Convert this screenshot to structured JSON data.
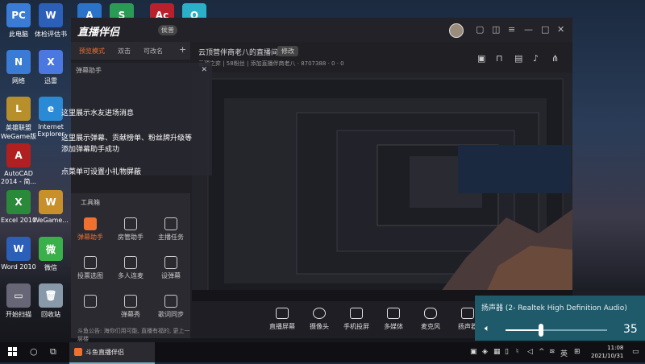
{
  "desktop": {
    "icons": [
      {
        "label": "此电脑",
        "color": "#3a7bd5",
        "glyph": "PC"
      },
      {
        "label": "体检评估书",
        "color": "#2b5fb8",
        "glyph": "W"
      },
      {
        "label": "",
        "color": "#2a73c9",
        "glyph": "A"
      },
      {
        "label": "",
        "color": "#2b9a55",
        "glyph": "S"
      },
      {
        "label": "",
        "color": "#b8202b",
        "glyph": "Ac"
      },
      {
        "label": "",
        "color": "#2ab0c8",
        "glyph": "O"
      },
      {
        "label": "网络",
        "color": "#3a7bd5",
        "glyph": "N"
      },
      {
        "label": "迅雷",
        "color": "#4a78e0",
        "glyph": "X"
      },
      {
        "label": "英雄联盟WeGame版",
        "color": "#b8902b",
        "glyph": "L"
      },
      {
        "label": "Internet Explorer",
        "color": "#2a8ad5",
        "glyph": "e"
      },
      {
        "label": "AutoCAD 2014 - 简...",
        "color": "#b02020",
        "glyph": "A"
      },
      {
        "label": "Excel 2010",
        "color": "#2a8a3a",
        "glyph": "X"
      },
      {
        "label": "WeGame...",
        "color": "#c8902b",
        "glyph": "W"
      },
      {
        "label": "Word 2010",
        "color": "#2b5fb8",
        "glyph": "W"
      },
      {
        "label": "微信",
        "color": "#3ab04a",
        "glyph": "微"
      },
      {
        "label": "开始扫描",
        "color": "#667",
        "glyph": "▭"
      },
      {
        "label": "回收站",
        "color": "#8899aa",
        "glyph": "🗑"
      }
    ]
  },
  "app": {
    "logo": "直播伴侣",
    "badge": "侯普",
    "tabs": [
      "预览模式",
      "双击",
      "可改名"
    ],
    "tab_add": "+",
    "room_title": "云顶营伴商老八的直播间",
    "room_badge": "修改",
    "room_info": "云顶之弈 | 58粉丝 | 添加直播伴商老八 · 8707388 · 0 · 0",
    "chat_overlay": {
      "title": "弹幕助手",
      "messages": [
        "这里展示水友进场消息",
        "这里展示弹幕、贡献榜单、粉丝牌升级等",
        "添加弹幕助手成功",
        "点菜单可设置小礼物屏蔽"
      ]
    },
    "toolbox": {
      "title": "工具箱",
      "tools": [
        {
          "label": "弹幕助手",
          "active": true
        },
        {
          "label": "房管助手",
          "active": false
        },
        {
          "label": "主播任务",
          "active": false
        },
        {
          "label": "投票选图",
          "active": false
        },
        {
          "label": "多人连麦",
          "active": false
        },
        {
          "label": "设弹幕",
          "active": false
        },
        {
          "label": "",
          "active": false
        },
        {
          "label": "弹幕秀",
          "active": false
        },
        {
          "label": "歌词同步",
          "active": false
        }
      ],
      "notice": "斗鱼公告: 海你们用可能, 直播有福的, 更上一层楼"
    },
    "bottom_bar": [
      "直播屏幕",
      "摄像头",
      "手机投屏",
      "多媒体",
      "麦克风",
      "扬声器"
    ],
    "speaker_popup": {
      "title": "扬声器 (2- Realtek High Definition Audio)",
      "value": "35",
      "level": 0.35
    }
  },
  "taskbar": {
    "app_label": "斗鱼直播伴侣",
    "tray_lang": "英",
    "time": "11:08",
    "date": "2021/10/31"
  }
}
